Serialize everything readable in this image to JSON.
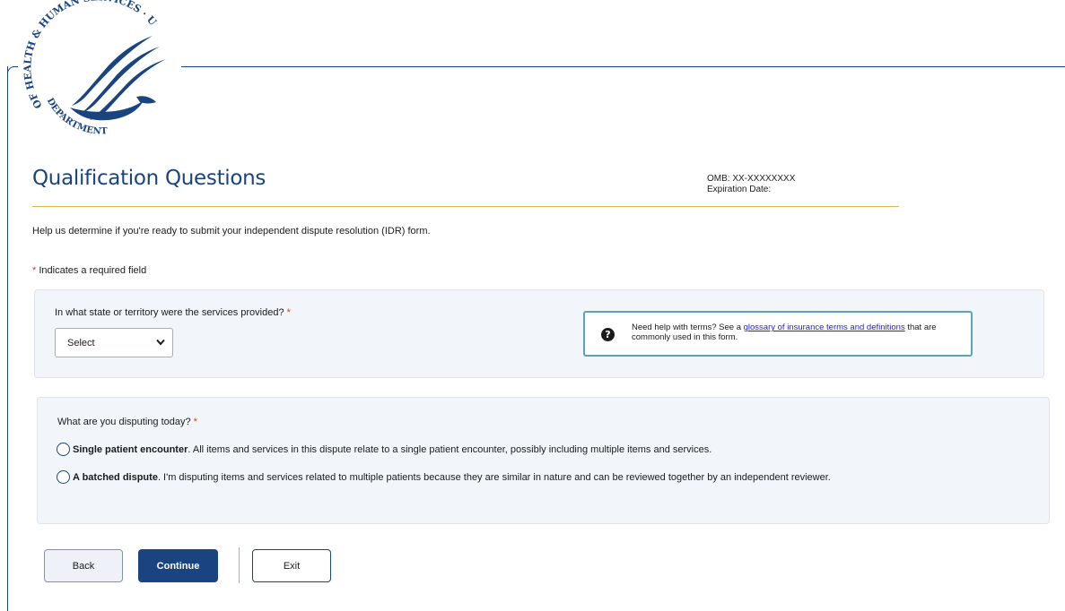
{
  "logo": {
    "seal_text_top": "SERVICES · USA",
    "seal_text_left": "OF HEALTH & HUMAN",
    "seal_text_bottom": "DEPARTMENT",
    "color": "#1a4480"
  },
  "header": {
    "title": "Qualification Questions",
    "omb": "OMB: XX-XXXXXXXX",
    "expiration": "Expiration Date:"
  },
  "intro": "Help us determine if you're ready to submit your independent dispute resolution (IDR) form.",
  "required_note": {
    "star": "*",
    "text": "Indicates a required field"
  },
  "state_question": {
    "label": "In what state or territory were the services provided?",
    "star": "*",
    "select_value": "Select"
  },
  "help": {
    "text_before": "Need help with terms? See a ",
    "link": "glossary of insurance terms and definitions",
    "text_after": " that are commonly used in this form."
  },
  "dispute_question": {
    "label": "What are you disputing today?",
    "star": "*",
    "options": [
      {
        "bold": "Single patient encounter",
        "text": ". All items and services in this dispute relate to a single patient encounter, possibly including multiple items and services."
      },
      {
        "bold": "A batched dispute",
        "text": ". I'm disputing items and services related to multiple patients because they are similar in nature and can be reviewed together by an independent reviewer."
      }
    ]
  },
  "buttons": {
    "back": "Back",
    "continue": "Continue",
    "exit": "Exit"
  },
  "colors": {
    "primary": "#1a4480",
    "accent_rule": "#d9b94a",
    "required": "#d63e04",
    "panel_bg": "#f2f6fb",
    "help_border": "#5ba4b8"
  }
}
